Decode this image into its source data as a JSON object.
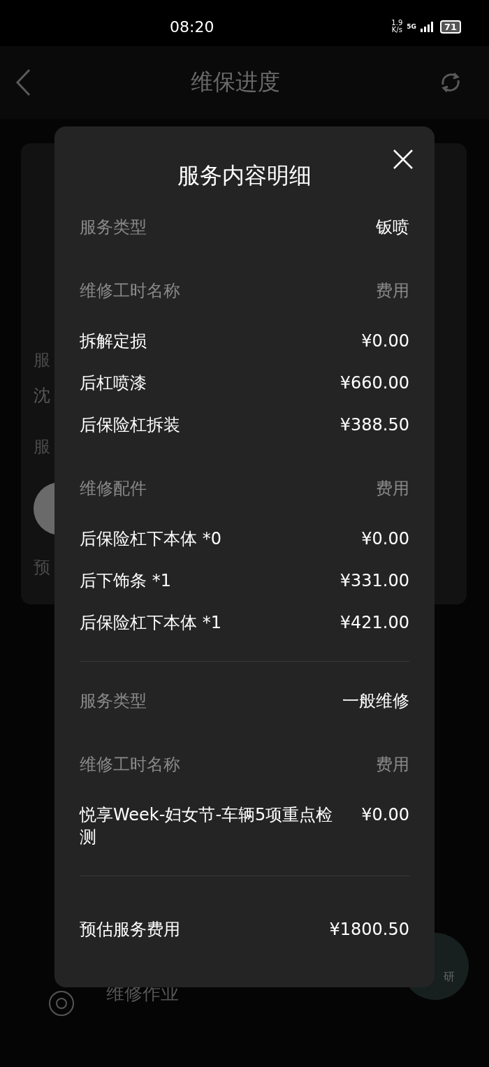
{
  "status_bar": {
    "time": "08:20",
    "net_speed_value": "1.9",
    "net_speed_unit": "K/s",
    "network": "5G",
    "battery": "71"
  },
  "header": {
    "title": "维保进度"
  },
  "background": {
    "fragments": [
      "服",
      "沈",
      "服",
      "预"
    ],
    "step_label": "维修作业",
    "fab_text": "研"
  },
  "modal": {
    "title": "服务内容明细",
    "blocks": [
      {
        "kind": "type",
        "label": "服务类型",
        "value": "钣喷"
      },
      {
        "kind": "header",
        "label": "维修工时名称",
        "value": "费用"
      },
      {
        "kind": "item",
        "label": "拆解定损",
        "value": "¥0.00"
      },
      {
        "kind": "item",
        "label": "后杠喷漆",
        "value": "¥660.00"
      },
      {
        "kind": "item",
        "label": "后保险杠拆装",
        "value": "¥388.50"
      },
      {
        "kind": "header",
        "label": "维修配件",
        "value": "费用"
      },
      {
        "kind": "item",
        "label": "后保险杠下本体 *0",
        "value": "¥0.00"
      },
      {
        "kind": "item",
        "label": "后下饰条 *1",
        "value": "¥331.00"
      },
      {
        "kind": "item",
        "label": "后保险杠下本体 *1",
        "value": "¥421.00"
      },
      {
        "kind": "divider"
      },
      {
        "kind": "type",
        "label": "服务类型",
        "value": "一般维修"
      },
      {
        "kind": "header",
        "label": "维修工时名称",
        "value": "费用"
      },
      {
        "kind": "item",
        "label": "悦享Week-妇女节-车辆5项重点检测",
        "value": "¥0.00"
      },
      {
        "kind": "divider"
      },
      {
        "kind": "total",
        "label": "预估服务费用",
        "value": "¥1800.50"
      }
    ]
  }
}
